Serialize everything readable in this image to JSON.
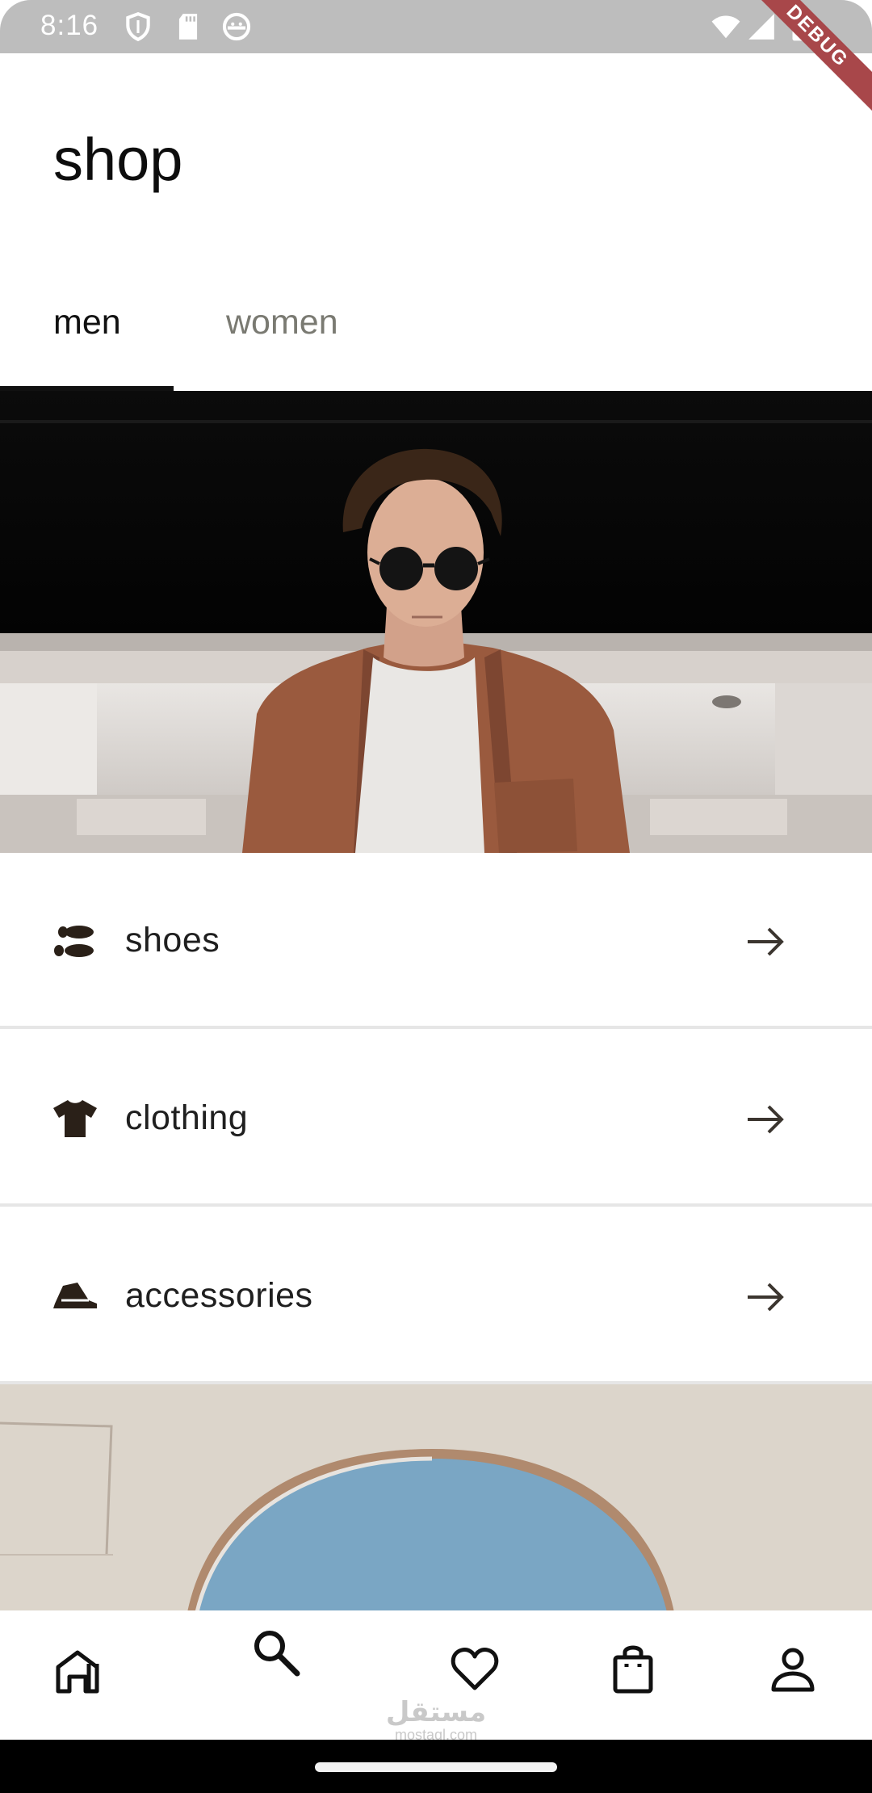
{
  "status_bar": {
    "time": "8:16",
    "left_icons": [
      "shield-icon",
      "sd-card-icon",
      "android-face-icon"
    ],
    "right_icons": [
      "wifi-icon",
      "signal-icon",
      "battery-icon"
    ],
    "debug_label": "DEBUG"
  },
  "header": {
    "title": "shop"
  },
  "tabs": [
    {
      "label": "men",
      "selected": true
    },
    {
      "label": "women",
      "selected": false
    }
  ],
  "categories": [
    {
      "label": "shoes",
      "icon": "footprints-icon"
    },
    {
      "label": "clothing",
      "icon": "tshirt-icon"
    },
    {
      "label": "accessories",
      "icon": "hat-icon"
    }
  ],
  "bottom_nav": {
    "items": [
      "home-icon",
      "search-icon",
      "heart-icon",
      "shopping-bag-icon",
      "profile-icon"
    ]
  },
  "watermark": {
    "arabic": "مستقل",
    "latin": "mostaql.com"
  },
  "colors": {
    "tab_inactive": "#7a7a72",
    "debug_banner": "#a8474a",
    "jacket": "#9a5a3e",
    "sky_arch": "#7aa6c4"
  }
}
